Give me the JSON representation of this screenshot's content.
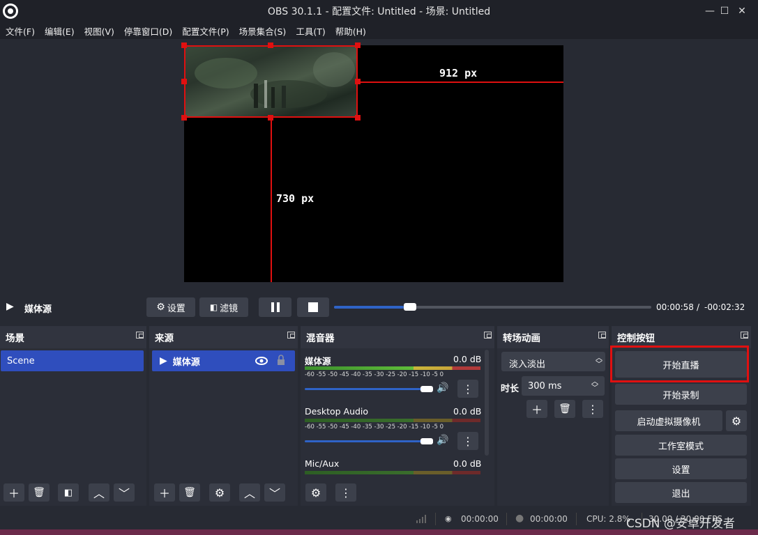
{
  "window": {
    "title": "OBS 30.1.1 - 配置文件: Untitled - 场景: Untitled",
    "min": "—",
    "max": "☐",
    "close": "✕"
  },
  "menu": [
    "文件(F)",
    "编辑(E)",
    "视图(V)",
    "停靠窗口(D)",
    "配置文件(P)",
    "场景集合(S)",
    "工具(T)",
    "帮助(H)"
  ],
  "preview": {
    "width_label": "912 px",
    "height_label": "730 px"
  },
  "media_controls": {
    "source_name": "媒体源",
    "settings_label": "设置",
    "filters_label": "滤镜",
    "elapsed": "00:00:58",
    "separator": "/",
    "remaining": "-00:02:32",
    "progress_fraction": 0.22
  },
  "scenes": {
    "title": "场景",
    "items": [
      "Scene"
    ]
  },
  "sources": {
    "title": "来源",
    "items": [
      "媒体源"
    ]
  },
  "mixer": {
    "title": "混音器",
    "tick_labels": "-60 -55 -50 -45 -40 -35 -30 -25 -20 -15 -10 -5 0",
    "channels": [
      {
        "name": "媒体源",
        "db": "0.0 dB"
      },
      {
        "name": "Desktop Audio",
        "db": "0.0 dB"
      },
      {
        "name": "Mic/Aux",
        "db": "0.0 dB"
      }
    ]
  },
  "transitions": {
    "title": "转场动画",
    "selected": "淡入淡出",
    "duration_label": "时长",
    "duration_value": "300 ms"
  },
  "controls": {
    "title": "控制按钮",
    "start_stream": "开始直播",
    "start_record": "开始录制",
    "virtual_cam": "启动虚拟摄像机",
    "studio_mode": "工作室模式",
    "settings": "设置",
    "exit": "退出"
  },
  "status": {
    "stream_time": "00:00:00",
    "record_time": "00:00:00",
    "cpu": "CPU: 2.8%",
    "fps": "30.00 / 30.00 FPS"
  },
  "watermark": "CSDN @安卓开发者",
  "colors": {
    "accent": "#2f4ebd",
    "highlight_box": "#e01010"
  }
}
